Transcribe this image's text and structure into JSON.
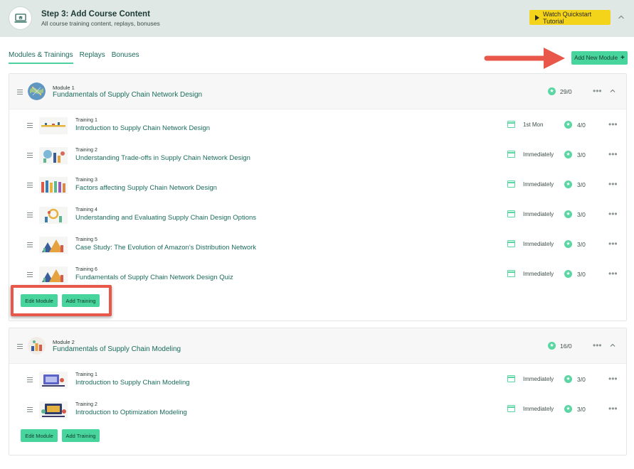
{
  "banner": {
    "title": "Step 3: Add Course Content",
    "subtitle": "All course training content, replays, bonuses",
    "quickstart_label": "Watch Quickstart Tutorial",
    "icon": "laptop-graduation-icon"
  },
  "tabs": [
    {
      "label": "Modules & Trainings",
      "active": true
    },
    {
      "label": "Replays",
      "active": false
    },
    {
      "label": "Bonuses",
      "active": false
    }
  ],
  "add_module_label": "Add New Module",
  "add_module_plus": "+",
  "colors": {
    "accent": "#47d59d",
    "link": "#1a6c5b",
    "banner_bg": "#dfe8e4",
    "annotation_red": "#e8574a",
    "quickstart": "#f4d41a"
  },
  "modules": [
    {
      "kicker": "Module 1",
      "title": "Fundamentals of Supply Chain Network Design",
      "score": "29/0",
      "edit_label": "Edit Module",
      "add_training_label": "Add Training",
      "trainings": [
        {
          "kicker": "Training 1",
          "title": "Introduction to Supply Chain Network Design",
          "drip": "1st Mon",
          "score": "4/0"
        },
        {
          "kicker": "Training 2",
          "title": "Understanding Trade-offs in Supply Chain Network Design",
          "drip": "Immediately",
          "score": "3/0"
        },
        {
          "kicker": "Training 3",
          "title": "Factors affecting Supply Chain Network Design",
          "drip": "Immediately",
          "score": "3/0"
        },
        {
          "kicker": "Training 4",
          "title": "Understanding and Evaluating Supply Chain Design Options",
          "drip": "Immediately",
          "score": "3/0"
        },
        {
          "kicker": "Training 5",
          "title": "Case Study: The Evolution of Amazon's Distribution Network",
          "drip": "Immediately",
          "score": "3/0"
        },
        {
          "kicker": "Training 6",
          "title": "Fundamentals of Supply Chain Network Design Quiz",
          "drip": "Immediately",
          "score": "3/0"
        }
      ]
    },
    {
      "kicker": "Module 2",
      "title": "Fundamentals of Supply Chain Modeling",
      "score": "16/0",
      "edit_label": "Edit Module",
      "add_training_label": "Add Training",
      "trainings": [
        {
          "kicker": "Training 1",
          "title": "Introduction to Supply Chain Modeling",
          "drip": "Immediately",
          "score": "3/0"
        },
        {
          "kicker": "Training 2",
          "title": "Introduction to Optimization Modeling",
          "drip": "Immediately",
          "score": "3/0"
        }
      ]
    }
  ]
}
